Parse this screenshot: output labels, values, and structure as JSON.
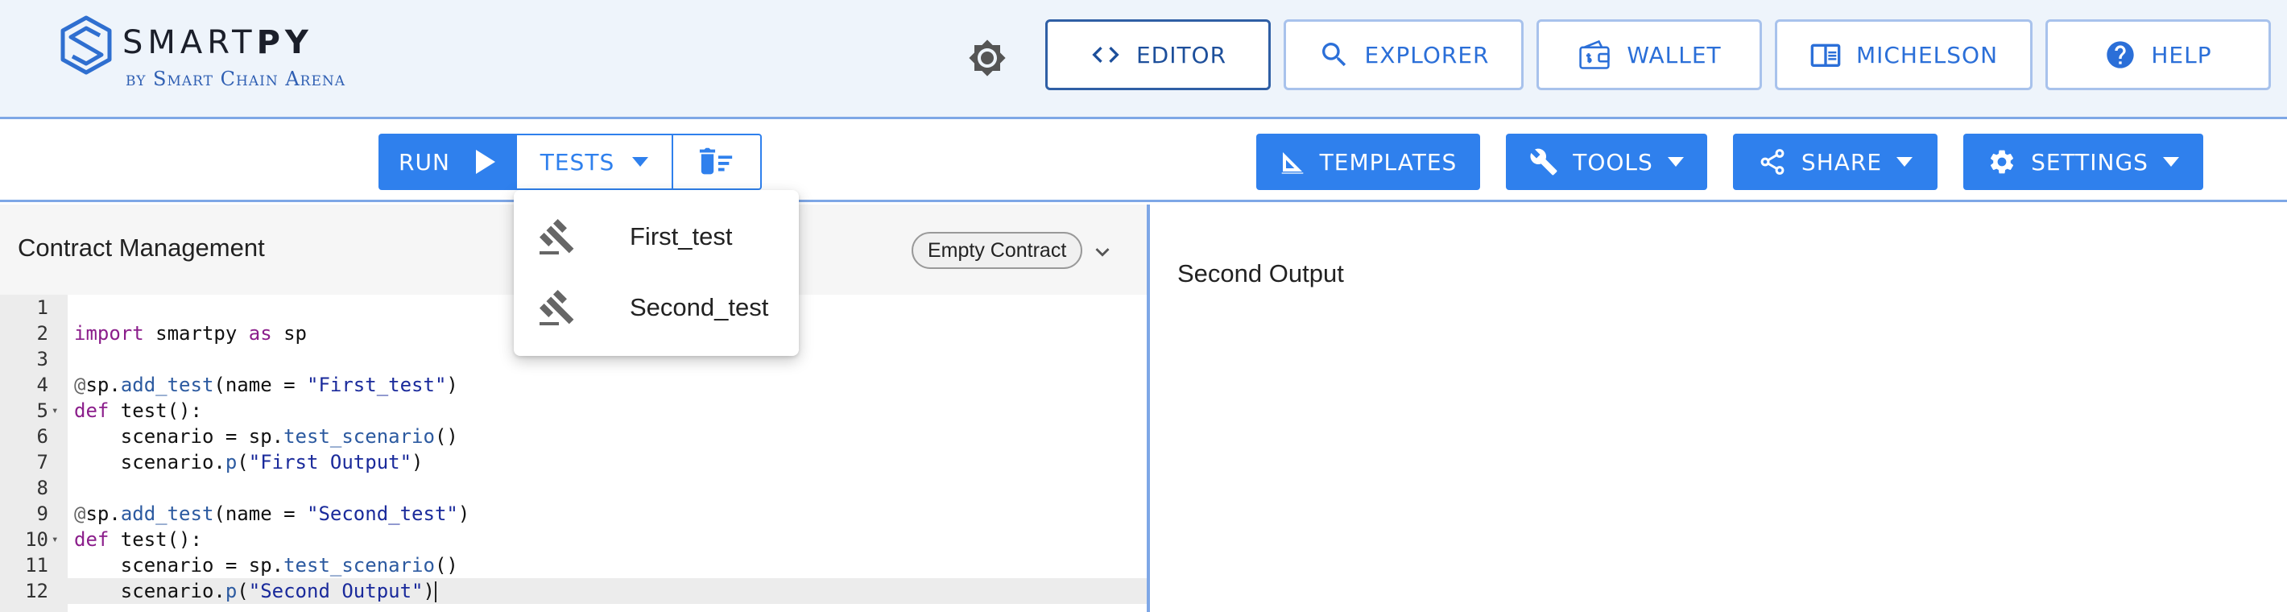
{
  "brand": {
    "name_light": "SMART",
    "name_bold": "PY",
    "tagline": "by Smart Chain Arena"
  },
  "nav": {
    "editor": "EDITOR",
    "explorer": "EXPLORER",
    "wallet": "WALLET",
    "michelson": "MICHELSON",
    "help": "HELP"
  },
  "toolbar": {
    "run": "RUN",
    "tests": "TESTS",
    "templates": "TEMPLATES",
    "tools": "TOOLS",
    "share": "SHARE",
    "settings": "SETTINGS"
  },
  "contract_panel": {
    "title": "Contract Management",
    "selected_contract": "Empty Contract"
  },
  "tests_menu": {
    "items": [
      {
        "label": "First_test"
      },
      {
        "label": "Second_test"
      }
    ]
  },
  "output": {
    "text": "Second Output"
  },
  "editor": {
    "line_numbers": [
      "1",
      "2",
      "3",
      "4",
      "5",
      "6",
      "7",
      "8",
      "9",
      "10",
      "11",
      "12"
    ],
    "lines": [
      "",
      "import smartpy as sp",
      "",
      "@sp.add_test(name = \"First_test\")",
      "def test():",
      "    scenario = sp.test_scenario()",
      "    scenario.p(\"First Output\")",
      "",
      "@sp.add_test(name = \"Second_test\")",
      "def test():",
      "    scenario = sp.test_scenario()",
      "    scenario.p(\"Second Output\")"
    ]
  },
  "colors": {
    "accent": "#2f80ed",
    "header_bg": "#eef4fb",
    "divider": "#7ea7e6"
  }
}
